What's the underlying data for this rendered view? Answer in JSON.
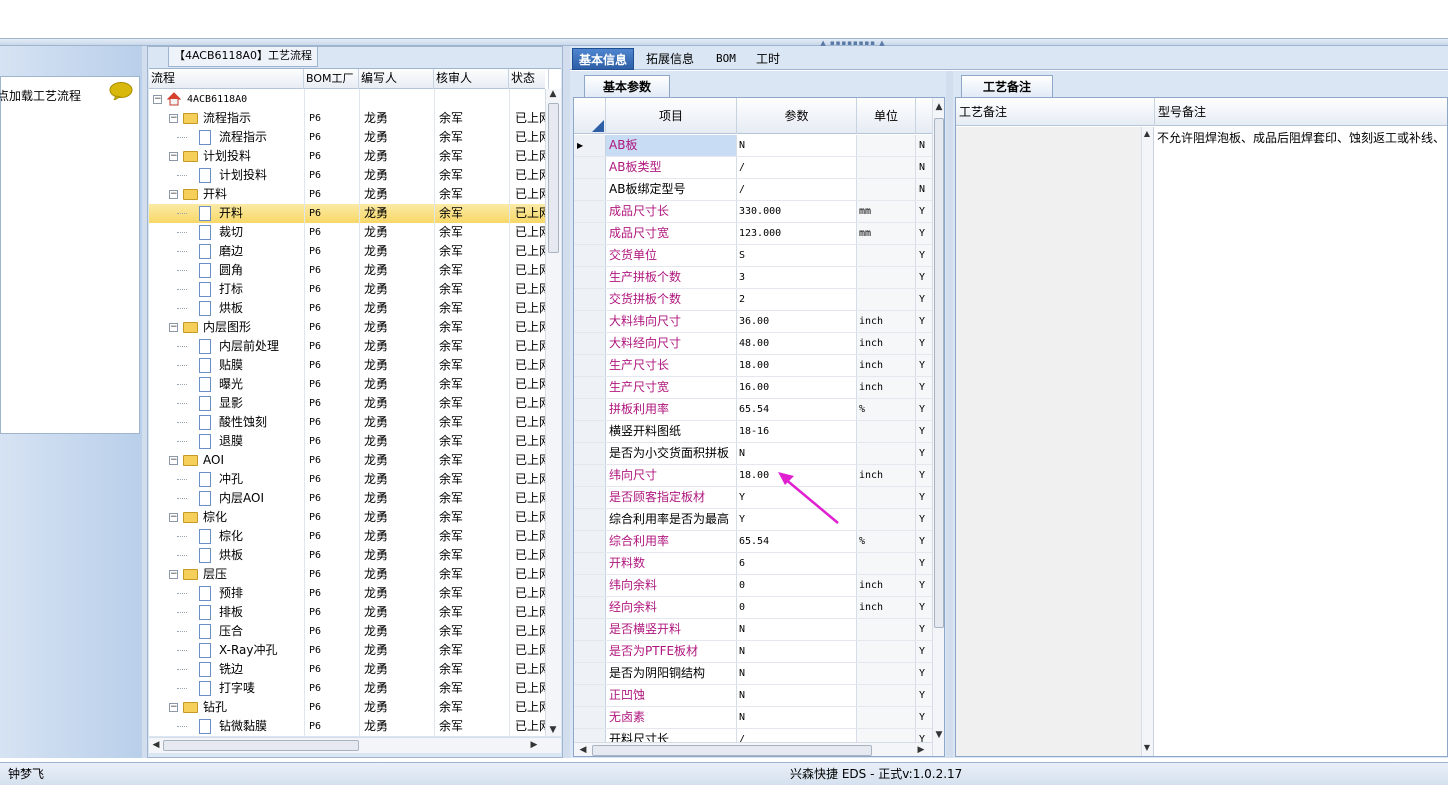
{
  "left_panel": {
    "load_hint": "点加载工艺流程"
  },
  "tree": {
    "title": "【4ACB6118A0】工艺流程",
    "headers": [
      "流程",
      "BOM工厂",
      "编写人",
      "核审人",
      "状态"
    ],
    "rows": [
      {
        "name": "4ACB6118A0",
        "level": 0,
        "kind": "root",
        "bom": "",
        "editor": "",
        "reviewer": "",
        "status": ""
      },
      {
        "name": "流程指示",
        "level": 1,
        "kind": "folder",
        "bom": "P6",
        "editor": "龙勇",
        "reviewer": "余军",
        "status": "已上网"
      },
      {
        "name": "流程指示",
        "level": 2,
        "kind": "doc",
        "bom": "P6",
        "editor": "龙勇",
        "reviewer": "余军",
        "status": "已上网"
      },
      {
        "name": "计划投料",
        "level": 1,
        "kind": "folder",
        "bom": "P6",
        "editor": "龙勇",
        "reviewer": "余军",
        "status": "已上网"
      },
      {
        "name": "计划投料",
        "level": 2,
        "kind": "doc",
        "bom": "P6",
        "editor": "龙勇",
        "reviewer": "余军",
        "status": "已上网"
      },
      {
        "name": "开料",
        "level": 1,
        "kind": "folder",
        "bom": "P6",
        "editor": "龙勇",
        "reviewer": "余军",
        "status": "已上网"
      },
      {
        "name": "开料",
        "level": 2,
        "kind": "doc",
        "bom": "P6",
        "editor": "龙勇",
        "reviewer": "余军",
        "status": "已上网",
        "selected": true
      },
      {
        "name": "裁切",
        "level": 2,
        "kind": "doc",
        "bom": "P6",
        "editor": "龙勇",
        "reviewer": "余军",
        "status": "已上网"
      },
      {
        "name": "磨边",
        "level": 2,
        "kind": "doc",
        "bom": "P6",
        "editor": "龙勇",
        "reviewer": "余军",
        "status": "已上网"
      },
      {
        "name": "圆角",
        "level": 2,
        "kind": "doc",
        "bom": "P6",
        "editor": "龙勇",
        "reviewer": "余军",
        "status": "已上网"
      },
      {
        "name": "打标",
        "level": 2,
        "kind": "doc",
        "bom": "P6",
        "editor": "龙勇",
        "reviewer": "余军",
        "status": "已上网"
      },
      {
        "name": "烘板",
        "level": 2,
        "kind": "doc",
        "bom": "P6",
        "editor": "龙勇",
        "reviewer": "余军",
        "status": "已上网"
      },
      {
        "name": "内层图形",
        "level": 1,
        "kind": "folder",
        "bom": "P6",
        "editor": "龙勇",
        "reviewer": "余军",
        "status": "已上网"
      },
      {
        "name": "内层前处理",
        "level": 2,
        "kind": "doc",
        "bom": "P6",
        "editor": "龙勇",
        "reviewer": "余军",
        "status": "已上网"
      },
      {
        "name": "贴膜",
        "level": 2,
        "kind": "doc",
        "bom": "P6",
        "editor": "龙勇",
        "reviewer": "余军",
        "status": "已上网"
      },
      {
        "name": "曝光",
        "level": 2,
        "kind": "doc",
        "bom": "P6",
        "editor": "龙勇",
        "reviewer": "余军",
        "status": "已上网"
      },
      {
        "name": "显影",
        "level": 2,
        "kind": "doc",
        "bom": "P6",
        "editor": "龙勇",
        "reviewer": "余军",
        "status": "已上网"
      },
      {
        "name": "酸性蚀刻",
        "level": 2,
        "kind": "doc",
        "bom": "P6",
        "editor": "龙勇",
        "reviewer": "余军",
        "status": "已上网"
      },
      {
        "name": "退膜",
        "level": 2,
        "kind": "doc",
        "bom": "P6",
        "editor": "龙勇",
        "reviewer": "余军",
        "status": "已上网"
      },
      {
        "name": "AOI",
        "level": 1,
        "kind": "folder",
        "bom": "P6",
        "editor": "龙勇",
        "reviewer": "余军",
        "status": "已上网"
      },
      {
        "name": "冲孔",
        "level": 2,
        "kind": "doc",
        "bom": "P6",
        "editor": "龙勇",
        "reviewer": "余军",
        "status": "已上网"
      },
      {
        "name": "内层AOI",
        "level": 2,
        "kind": "doc",
        "bom": "P6",
        "editor": "龙勇",
        "reviewer": "余军",
        "status": "已上网"
      },
      {
        "name": "棕化",
        "level": 1,
        "kind": "folder",
        "bom": "P6",
        "editor": "龙勇",
        "reviewer": "余军",
        "status": "已上网"
      },
      {
        "name": "棕化",
        "level": 2,
        "kind": "doc",
        "bom": "P6",
        "editor": "龙勇",
        "reviewer": "余军",
        "status": "已上网"
      },
      {
        "name": "烘板",
        "level": 2,
        "kind": "doc",
        "bom": "P6",
        "editor": "龙勇",
        "reviewer": "余军",
        "status": "已上网"
      },
      {
        "name": "层压",
        "level": 1,
        "kind": "folder",
        "bom": "P6",
        "editor": "龙勇",
        "reviewer": "余军",
        "status": "已上网"
      },
      {
        "name": "预排",
        "level": 2,
        "kind": "doc",
        "bom": "P6",
        "editor": "龙勇",
        "reviewer": "余军",
        "status": "已上网"
      },
      {
        "name": "排板",
        "level": 2,
        "kind": "doc",
        "bom": "P6",
        "editor": "龙勇",
        "reviewer": "余军",
        "status": "已上网"
      },
      {
        "name": "压合",
        "level": 2,
        "kind": "doc",
        "bom": "P6",
        "editor": "龙勇",
        "reviewer": "余军",
        "status": "已上网"
      },
      {
        "name": "X-Ray冲孔",
        "level": 2,
        "kind": "doc",
        "bom": "P6",
        "editor": "龙勇",
        "reviewer": "余军",
        "status": "已上网"
      },
      {
        "name": "铣边",
        "level": 2,
        "kind": "doc",
        "bom": "P6",
        "editor": "龙勇",
        "reviewer": "余军",
        "status": "已上网"
      },
      {
        "name": "打字唛",
        "level": 2,
        "kind": "doc",
        "bom": "P6",
        "editor": "龙勇",
        "reviewer": "余军",
        "status": "已上网"
      },
      {
        "name": "钻孔",
        "level": 1,
        "kind": "folder",
        "bom": "P6",
        "editor": "龙勇",
        "reviewer": "余军",
        "status": "已上网"
      },
      {
        "name": "钻微黏膜",
        "level": 2,
        "kind": "doc",
        "bom": "P6",
        "editor": "龙勇",
        "reviewer": "余军",
        "status": "已上网"
      }
    ]
  },
  "main_tabs": [
    "基本信息",
    "拓展信息",
    "BOM",
    "工时"
  ],
  "params": {
    "tab": "基本参数",
    "headers": [
      "项目",
      "参数",
      "单位"
    ],
    "rows": [
      {
        "item": "AB板",
        "value": "N",
        "unit": "",
        "flag": "N",
        "highlight": true,
        "current": true
      },
      {
        "item": "AB板类型",
        "value": "/",
        "unit": "",
        "flag": "N",
        "highlight": true
      },
      {
        "item": "AB板绑定型号",
        "value": "/",
        "unit": "",
        "flag": "N",
        "highlight": false
      },
      {
        "item": "成品尺寸长",
        "value": "330.000",
        "unit": "mm",
        "flag": "Y",
        "highlight": true
      },
      {
        "item": "成品尺寸宽",
        "value": "123.000",
        "unit": "mm",
        "flag": "Y",
        "highlight": true
      },
      {
        "item": "交货单位",
        "value": "S",
        "unit": "",
        "flag": "Y",
        "highlight": true
      },
      {
        "item": "生产拼板个数",
        "value": "3",
        "unit": "",
        "flag": "Y",
        "highlight": true
      },
      {
        "item": "交货拼板个数",
        "value": "2",
        "unit": "",
        "flag": "Y",
        "highlight": true
      },
      {
        "item": "大料纬向尺寸",
        "value": "36.00",
        "unit": "inch",
        "flag": "Y",
        "highlight": true
      },
      {
        "item": "大料经向尺寸",
        "value": "48.00",
        "unit": "inch",
        "flag": "Y",
        "highlight": true
      },
      {
        "item": "生产尺寸长",
        "value": "18.00",
        "unit": "inch",
        "flag": "Y",
        "highlight": true
      },
      {
        "item": "生产尺寸宽",
        "value": "16.00",
        "unit": "inch",
        "flag": "Y",
        "highlight": true
      },
      {
        "item": "拼板利用率",
        "value": "65.54",
        "unit": "%",
        "flag": "Y",
        "highlight": true
      },
      {
        "item": "横竖开料图纸",
        "value": "18-16",
        "unit": "",
        "flag": "Y",
        "highlight": false
      },
      {
        "item": "是否为小交货面积拼板",
        "value": "N",
        "unit": "",
        "flag": "Y",
        "highlight": false
      },
      {
        "item": "纬向尺寸",
        "value": "18.00",
        "unit": "inch",
        "flag": "Y",
        "highlight": true
      },
      {
        "item": "是否顾客指定板材",
        "value": "Y",
        "unit": "",
        "flag": "Y",
        "highlight": true
      },
      {
        "item": "综合利用率是否为最高",
        "value": "Y",
        "unit": "",
        "flag": "Y",
        "highlight": false
      },
      {
        "item": "综合利用率",
        "value": "65.54",
        "unit": "%",
        "flag": "Y",
        "highlight": true
      },
      {
        "item": "开料数",
        "value": "6",
        "unit": "",
        "flag": "Y",
        "highlight": true
      },
      {
        "item": "纬向余料",
        "value": "0",
        "unit": "inch",
        "flag": "Y",
        "highlight": true
      },
      {
        "item": "经向余料",
        "value": "0",
        "unit": "inch",
        "flag": "Y",
        "highlight": true
      },
      {
        "item": "是否横竖开料",
        "value": "N",
        "unit": "",
        "flag": "Y",
        "highlight": true
      },
      {
        "item": "是否为PTFE板材",
        "value": "N",
        "unit": "",
        "flag": "Y",
        "highlight": true
      },
      {
        "item": "是否为阴阳铜结构",
        "value": "N",
        "unit": "",
        "flag": "Y",
        "highlight": false
      },
      {
        "item": "正凹蚀",
        "value": "N",
        "unit": "",
        "flag": "Y",
        "highlight": true
      },
      {
        "item": "无卤素",
        "value": "N",
        "unit": "",
        "flag": "Y",
        "highlight": true
      },
      {
        "item": "开料尺寸长",
        "value": "/",
        "unit": "",
        "flag": "Y",
        "highlight": false
      }
    ]
  },
  "remarks": {
    "tab": "工艺备注",
    "headers": [
      "工艺备注",
      "型号备注"
    ],
    "model_note": "不允许阻焊泡板、成品后阻焊套印、蚀刻返工或补线、"
  },
  "status_bar": {
    "user": "钟梦飞",
    "app_version": "兴森快捷 EDS - 正式v:1.0.2.17"
  },
  "colors": {
    "accent_tab": "#2d5ea6",
    "highlight_text": "#b0177e",
    "selected_row": "#f8d867",
    "annotation_arrow": "#e020d0"
  }
}
